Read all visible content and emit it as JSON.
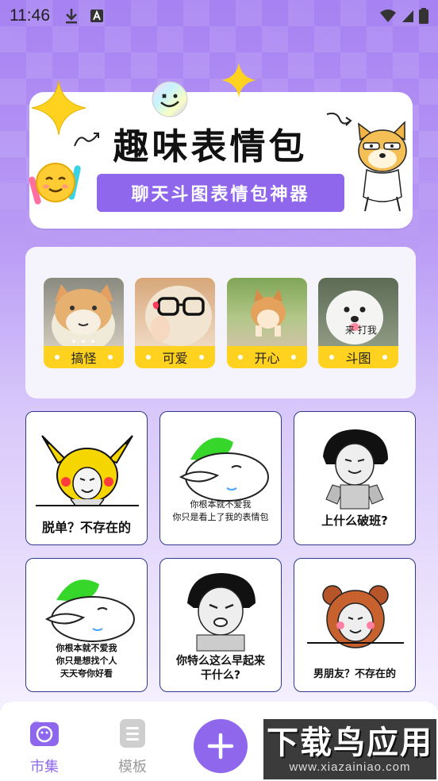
{
  "status_bar": {
    "time": "11:46"
  },
  "banner": {
    "title": "趣味表情包",
    "subtitle": "聊天斗图表情包神器"
  },
  "categories": [
    {
      "label": "搞怪"
    },
    {
      "label": "可爱"
    },
    {
      "label": "开心"
    },
    {
      "label": "斗图"
    }
  ],
  "category_image_texts": {
    "dog_text": "来 打我"
  },
  "memes": [
    {
      "caption": "脱单？不存在的"
    },
    {
      "caption_line1": "你根本就不爱我",
      "caption_line2": "你只是看上了我的表情包"
    },
    {
      "caption": "上什么破班?"
    },
    {
      "caption_line1": "你根本就不爱我",
      "caption_line2": "你只是想找个人",
      "caption_line3": "天天夸你好看"
    },
    {
      "caption_line1": "你特么这么早起来",
      "caption_line2": "干什么?"
    },
    {
      "caption": "男朋友？不存在的"
    }
  ],
  "bottom_nav": {
    "market_label": "市集",
    "template_label": "模板",
    "active_color": "#8e67ec"
  },
  "watermark": {
    "big": "下载鸟应用",
    "small": "www.xiazainiao.com"
  }
}
